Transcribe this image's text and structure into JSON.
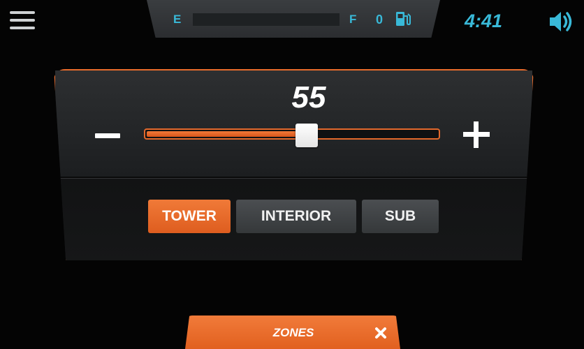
{
  "colors": {
    "accent": "#e86b2c",
    "info": "#39b9d8",
    "background": "#040404",
    "button_inactive": "#3f4245",
    "text": "#ffffff"
  },
  "top_bar": {
    "menu_icon": "hamburger-menu-icon",
    "fuel": {
      "empty_label": "E",
      "full_label": "F",
      "level_value": "0",
      "level_fraction": 0,
      "icon": "fuel-pump-icon"
    },
    "clock": "4:41",
    "volume_icon": "speaker-volume-icon"
  },
  "volume_panel": {
    "level": "55",
    "level_fraction": 0.55,
    "decrease_label": "−",
    "increase_label": "+",
    "zones": [
      {
        "label": "TOWER",
        "active": true
      },
      {
        "label": "INTERIOR",
        "active": false
      },
      {
        "label": "SUB",
        "active": false
      }
    ]
  },
  "bottom_tab": {
    "label": "ZONES",
    "close_icon": "close-x-icon"
  }
}
